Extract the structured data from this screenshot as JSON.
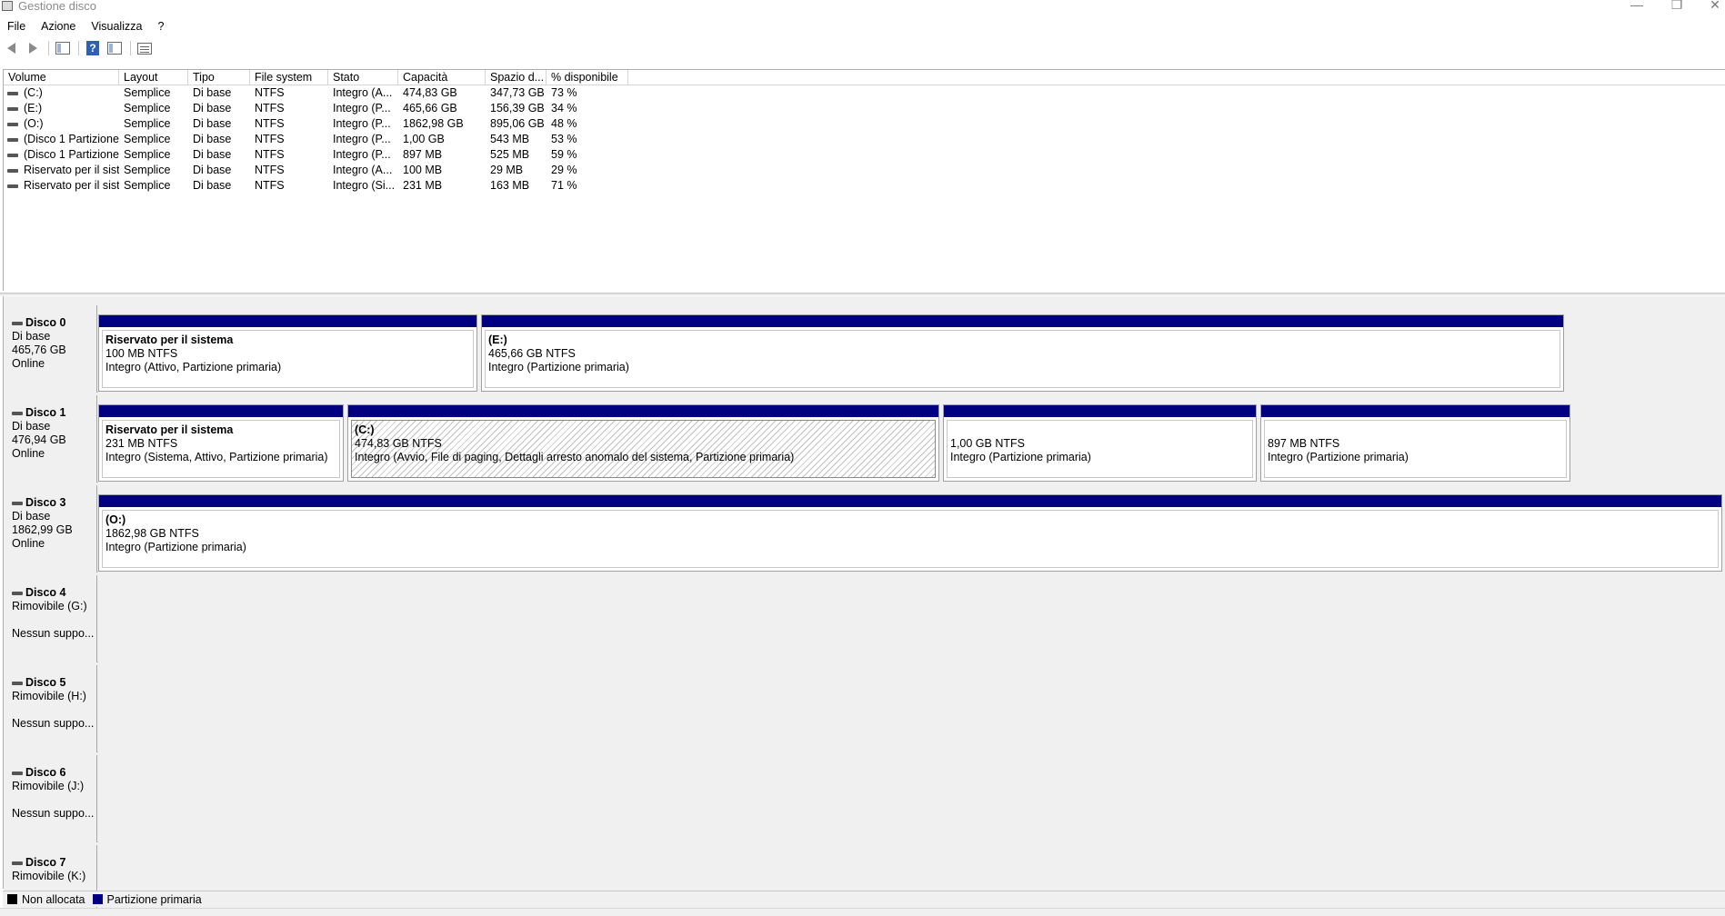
{
  "window": {
    "title": "Gestione disco",
    "minimize_glyph": "—",
    "maximize_glyph": "❐",
    "close_glyph": "✕"
  },
  "menu": [
    "File",
    "Azione",
    "Visualizza",
    "?"
  ],
  "toolbar": {
    "icons": [
      "back-arrow-icon",
      "forward-arrow-icon",
      "console-tree-icon",
      "help-icon",
      "properties-icon",
      "view-icon"
    ],
    "help_glyph": "?"
  },
  "volume_list": {
    "columns": [
      "Volume",
      "Layout",
      "Tipo",
      "File system",
      "Stato",
      "Capacità",
      "Spazio d...",
      "% disponibile"
    ],
    "rows": [
      [
        "(C:)",
        "Semplice",
        "Di base",
        "NTFS",
        "Integro (A...",
        "474,83 GB",
        "347,73 GB",
        "73 %"
      ],
      [
        "(E:)",
        "Semplice",
        "Di base",
        "NTFS",
        "Integro (P...",
        "465,66 GB",
        "156,39 GB",
        "34 %"
      ],
      [
        "(O:)",
        "Semplice",
        "Di base",
        "NTFS",
        "Integro (P...",
        "1862,98 GB",
        "895,06 GB",
        "48 %"
      ],
      [
        "(Disco 1 Partizione...",
        "Semplice",
        "Di base",
        "NTFS",
        "Integro (P...",
        "1,00 GB",
        "543 MB",
        "53 %"
      ],
      [
        "(Disco 1 Partizione...",
        "Semplice",
        "Di base",
        "NTFS",
        "Integro (P...",
        "897 MB",
        "525 MB",
        "59 %"
      ],
      [
        "Riservato per il sist...",
        "Semplice",
        "Di base",
        "NTFS",
        "Integro (A...",
        "100 MB",
        "29 MB",
        "29 %"
      ],
      [
        "Riservato per il sist...",
        "Semplice",
        "Di base",
        "NTFS",
        "Integro (Si...",
        "231 MB",
        "163 MB",
        "71 %"
      ]
    ]
  },
  "disks": [
    {
      "name": "Disco 0",
      "type": "Di base",
      "size": "465,76 GB",
      "status": "Online",
      "partitions": [
        {
          "name": "Riservato per il sistema",
          "size": "100 MB NTFS",
          "state": "Integro (Attivo, Partizione primaria)"
        },
        {
          "name": "(E:)",
          "size": "465,66 GB NTFS",
          "state": "Integro (Partizione primaria)"
        }
      ]
    },
    {
      "name": "Disco 1",
      "type": "Di base",
      "size": "476,94 GB",
      "status": "Online",
      "partitions": [
        {
          "name": "Riservato per il sistema",
          "size": "231 MB NTFS",
          "state": "Integro (Sistema, Attivo, Partizione primaria)"
        },
        {
          "name": "(C:)",
          "size": "474,83 GB NTFS",
          "state": "Integro (Avvio, File di paging, Dettagli arresto anomalo del sistema, Partizione primaria)"
        },
        {
          "name": "",
          "size": "1,00 GB NTFS",
          "state": "Integro (Partizione primaria)"
        },
        {
          "name": "",
          "size": "897 MB NTFS",
          "state": "Integro (Partizione primaria)"
        }
      ]
    },
    {
      "name": "Disco 3",
      "type": "Di base",
      "size": "1862,99 GB",
      "status": "Online",
      "partitions": [
        {
          "name": "(O:)",
          "size": "1862,98 GB NTFS",
          "state": "Integro (Partizione primaria)"
        }
      ]
    },
    {
      "name": "Disco 4",
      "type": "Rimovibile (G:)",
      "size": "",
      "status": "Nessun suppo...",
      "partitions": []
    },
    {
      "name": "Disco 5",
      "type": "Rimovibile (H:)",
      "size": "",
      "status": "Nessun suppo...",
      "partitions": []
    },
    {
      "name": "Disco 6",
      "type": "Rimovibile (J:)",
      "size": "",
      "status": "Nessun suppo...",
      "partitions": []
    },
    {
      "name": "Disco 7",
      "type": "Rimovibile (K:)",
      "size": "",
      "status": "",
      "partitions": []
    }
  ],
  "legend": [
    {
      "label": "Non allocata",
      "color": "#000000"
    },
    {
      "label": "Partizione primaria",
      "color": "#000080"
    }
  ]
}
